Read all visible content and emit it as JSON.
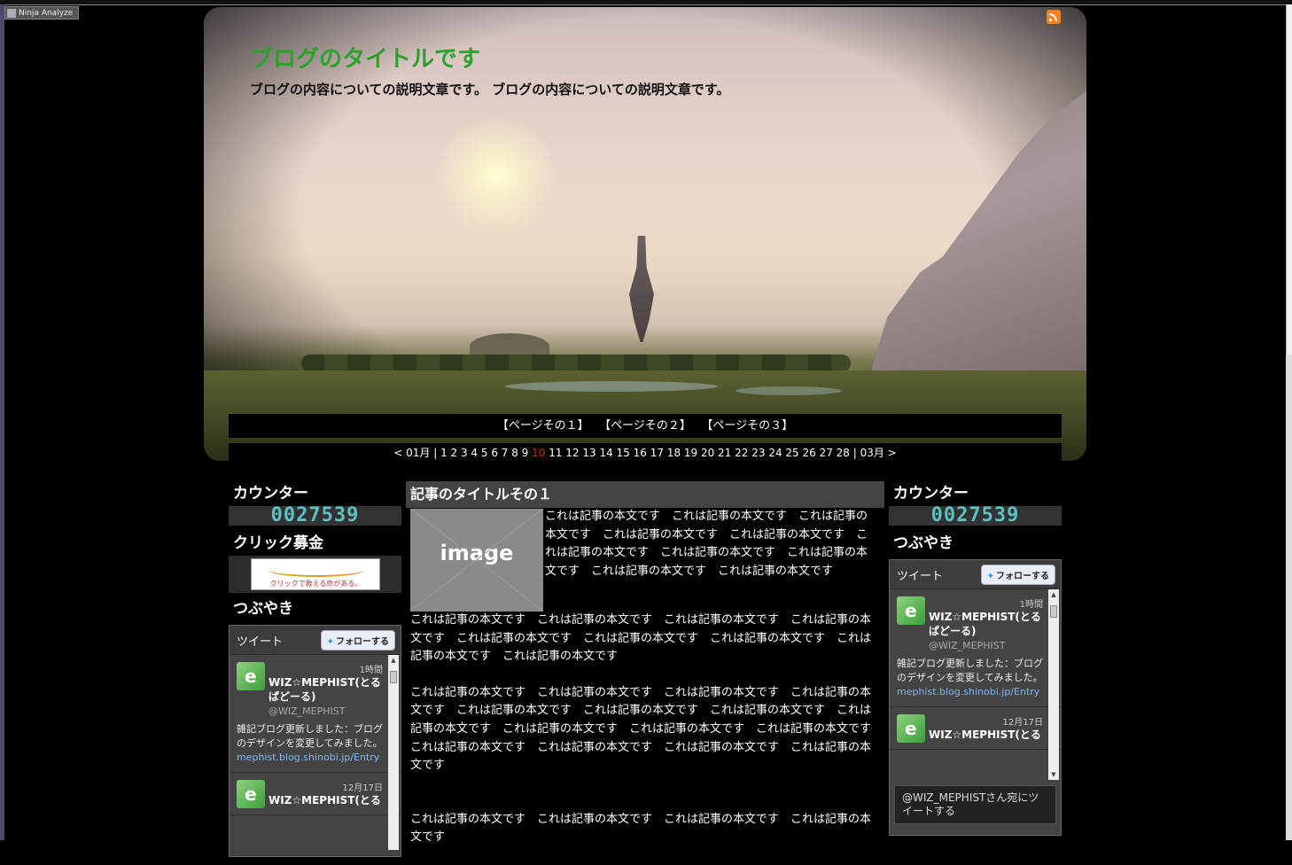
{
  "toolbar": {
    "ninja_label": "Ninja Analyze"
  },
  "header": {
    "title": "ブログのタイトルです",
    "description": "ブログの内容についての説明文章です。 ブログの内容についての説明文章です。"
  },
  "menu": [
    "【ページその１】",
    "【ページその２】",
    "【ページその３】"
  ],
  "calendar": {
    "prev": "< 01月",
    "days_before": "1 2 3 4 5 6 7 8 9 ",
    "today": "10",
    "days_after": " 11 12 13 14 15 16 17 18 19 20 21 22 23 24 25 26 27 28",
    "next": "03月 >"
  },
  "left": {
    "counter_title": "カウンター",
    "counter_value": "0027539",
    "bokin_title": "クリック募金",
    "bokin_text": "クリックで救える命がある。",
    "tweet_title": "つぶやき"
  },
  "right": {
    "counter_title": "カウンター",
    "counter_value": "0027539",
    "tweet_title": "つぶやき"
  },
  "twitter": {
    "header": "ツイート",
    "follow": "フォローする",
    "tweets": [
      {
        "time": "1時間",
        "name": "WIZ☆MEPHIST(とるぱどーる)",
        "handle": "@WIZ_MEPHIST",
        "text": "雑記ブログ更新しました：ブログのデザインを変更してみました。",
        "link": "mephist.blog.shinobi.jp/Entry"
      },
      {
        "time": "12月17日",
        "name": "WIZ☆MEPHIST(とる",
        "handle": "",
        "text": "",
        "link": ""
      }
    ],
    "reply": "@WIZ_MEPHISTさん宛にツイートする"
  },
  "post": {
    "title": "記事のタイトルその１",
    "image_label": "image",
    "p1": "これは記事の本文です　これは記事の本文です　これは記事の本文です　これは記事の本文です　これは記事の本文です　これは記事の本文です　これは記事の本文です　これは記事の本文です　これは記事の本文です　これは記事の本文です",
    "p2": "これは記事の本文です　これは記事の本文です　これは記事の本文です　これは記事の本文です　これは記事の本文です　これは記事の本文です　これは記事の本文です　これは記事の本文です　これは記事の本文です",
    "p3": "これは記事の本文です　これは記事の本文です　これは記事の本文です　これは記事の本文です　これは記事の本文です　これは記事の本文です　これは記事の本文です　これは記事の本文です　これは記事の本文です　これは記事の本文です　これは記事の本文です　これは記事の本文です　これは記事の本文です　これは記事の本文です　これは記事の本文です",
    "p4": "これは記事の本文です　これは記事の本文です　これは記事の本文です　これは記事の本文です"
  }
}
